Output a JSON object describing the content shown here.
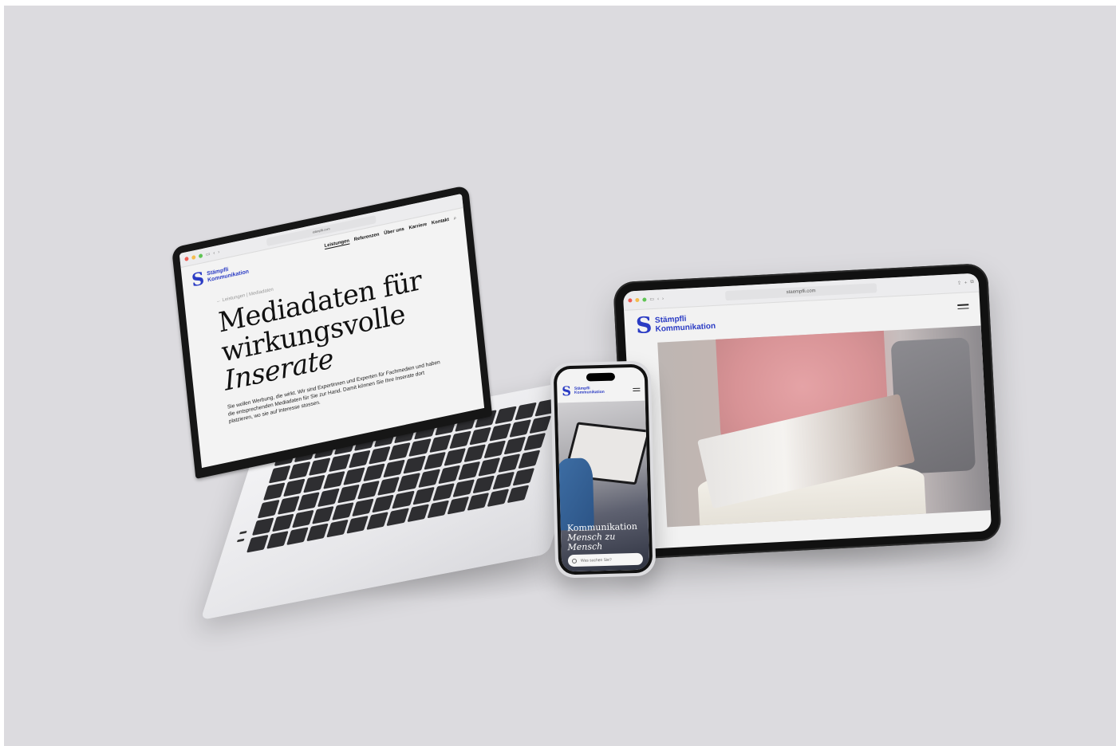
{
  "brand": {
    "name_line1": "Stämpfli",
    "name_line2": "Kommunikation",
    "logo_letter": "S",
    "color": "#2a3bc4"
  },
  "laptop": {
    "browser": {
      "url": "stämpfli.com"
    },
    "nav": [
      "Leistungen",
      "Referenzen",
      "Über uns",
      "Karriere",
      "Kontakt"
    ],
    "breadcrumb": "← Leistungen | Mediadaten",
    "title_line1": "Mediadaten für",
    "title_line2": "wirkungsvolle",
    "title_line3": "Inserate",
    "body": "Sie wollen Werbung, die wirkt. Wir sind Expertinnen und Experten für Fachmedien und haben die entsprechenden Mediadaten für Sie zur Hand. Damit können Sie Ihre Inserate dort platzieren, wo sie auf Interesse stossen."
  },
  "tablet": {
    "browser": {
      "url": "staempfli.com"
    }
  },
  "phone": {
    "caption_line1": "Kommunikation",
    "caption_line2": "Mensch zu Mensch",
    "search_placeholder": "Was suchen Sie?"
  }
}
